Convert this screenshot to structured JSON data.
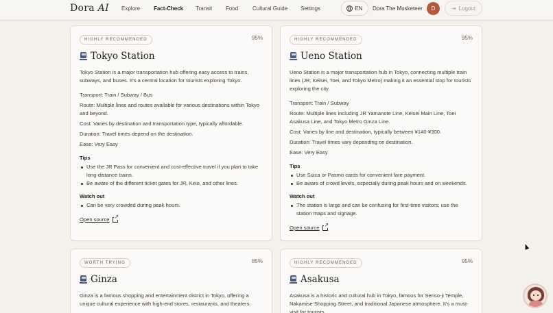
{
  "header": {
    "logo_main": "Dora",
    "logo_ai": "AI",
    "nav": [
      "Explore",
      "Fact-Check",
      "Transit",
      "Food",
      "Cultural Guide",
      "Settings"
    ],
    "active_nav": "Fact-Check",
    "language": "EN",
    "user_name": "Dora The Musketeer",
    "avatar_initial": "D",
    "logout_label": "Logout"
  },
  "cards": [
    {
      "badge": "HIGHLY RECOMMENDED",
      "score": "95%",
      "title": "Tokyo Station",
      "description": "Tokyo Station is a major transportation hub offering easy access to trains, subways, and buses. It's a central location for tourists exploring Tokyo.",
      "transport": "Transport: Train / Subway / Bus",
      "route": "Route: Multiple lines and routes available for various destinations within Tokyo and beyond.",
      "cost": "Cost: Varies by destination and transportation type, typically affordable.",
      "duration": "Duration: Travel times depend on the destination.",
      "ease": "Ease: Very Easy",
      "tips_heading": "Tips",
      "tips": [
        "Use the JR Pass for convenient and cost-effective travel if you plan to take long-distance trains.",
        "Be aware of the different ticket gates for JR, Keio, and other lines."
      ],
      "watch_heading": "Watch out",
      "watch": [
        "Can be very crowded during peak hours."
      ],
      "source_label": "Open source"
    },
    {
      "badge": "HIGHLY RECOMMENDED",
      "score": "95%",
      "title": "Ueno Station",
      "description": "Ueno Station is a major transportation hub in Tokyo, connecting multiple train lines (JR, Keisei, Toei, and Tokyo Metro) making it an essential stop for tourists exploring the city.",
      "transport": "Transport: Train / Subway",
      "route": "Route: Multiple lines including JR Yamanote Line, Keisei Main Line, Toei Asakusa Line, and Tokyo Metro Ginza Line.",
      "cost": "Cost: Varies by line and destination, typically between ¥140-¥300.",
      "duration": "Duration: Travel times vary depending on destination.",
      "ease": "Ease: Very Easy",
      "tips_heading": "Tips",
      "tips": [
        "Use Suica or Pasmo cards for convenient fare payment.",
        "Be aware of crowd levels, especially during peak hours and on weekends."
      ],
      "watch_heading": "Watch out",
      "watch": [
        "The station is large and can be confusing for first-time visitors; use the station maps and signage."
      ],
      "source_label": "Open source"
    },
    {
      "badge": "WORTH TRYING",
      "score": "85%",
      "title": "Ginza",
      "description": "Ginza is a famous shopping and entertainment district in Tokyo, offering a unique cultural experience with high-end stores, restaurants, and theaters."
    },
    {
      "badge": "HIGHLY RECOMMENDED",
      "score": "95%",
      "title": "Asakusa",
      "description": "Asakusa is a historic and cultural hub in Tokyo, famous for Senso-ji Temple, Nakamise Shopping Street, and traditional Japanese atmosphere. It's a must-visit for tourists."
    }
  ]
}
